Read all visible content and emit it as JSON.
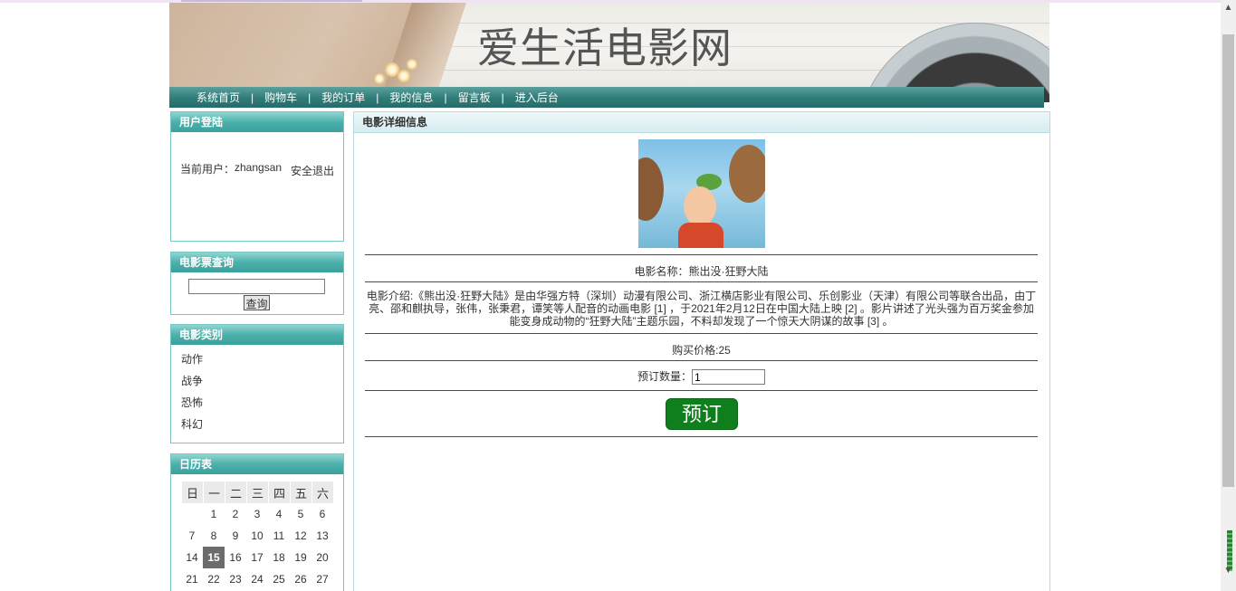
{
  "site": {
    "title": "爱生活电影网"
  },
  "nav": {
    "items": [
      {
        "label": "系统首页"
      },
      {
        "label": "购物车"
      },
      {
        "label": "我的订单"
      },
      {
        "label": "我的信息"
      },
      {
        "label": "留言板"
      },
      {
        "label": "进入后台"
      }
    ],
    "separator": "|"
  },
  "login": {
    "header": "用户登陆",
    "current_user_label": "当前用户：",
    "username": "zhangsan",
    "logout_label": "安全退出"
  },
  "search": {
    "header": "电影票查询",
    "input_value": "",
    "button_label": "查询"
  },
  "categories": {
    "header": "电影类别",
    "items": [
      "动作",
      "战争",
      "恐怖",
      "科幻"
    ]
  },
  "calendar": {
    "header": "日历表",
    "weekdays": [
      "日",
      "一",
      "二",
      "三",
      "四",
      "五",
      "六"
    ],
    "today": 15,
    "weeks": [
      [
        "",
        "1",
        "2",
        "3",
        "4",
        "5",
        "6"
      ],
      [
        "7",
        "8",
        "9",
        "10",
        "11",
        "12",
        "13"
      ],
      [
        "14",
        "15",
        "16",
        "17",
        "18",
        "19",
        "20"
      ],
      [
        "21",
        "22",
        "23",
        "24",
        "25",
        "26",
        "27"
      ]
    ]
  },
  "detail": {
    "header": "电影详细信息",
    "name_line": "电影名称：熊出没·狂野大陆",
    "intro_line": "电影介绍:《熊出没·狂野大陆》是由华强方特（深圳）动漫有限公司、浙江横店影业有限公司、乐创影业（天津）有限公司等联合出品，由丁亮、邵和麒执导，张伟，张秉君，谭笑等人配音的动画电影 [1] ，于2021年2月12日在中国大陆上映 [2] 。影片讲述了光头强为百万奖金参加能变身成动物的“狂野大陆”主题乐园，不料却发现了一个惊天大阴谋的故事 [3] 。",
    "price_line": "购买价格:25",
    "qty_label": "预订数量：",
    "qty_value": "1",
    "order_button": "预订"
  }
}
